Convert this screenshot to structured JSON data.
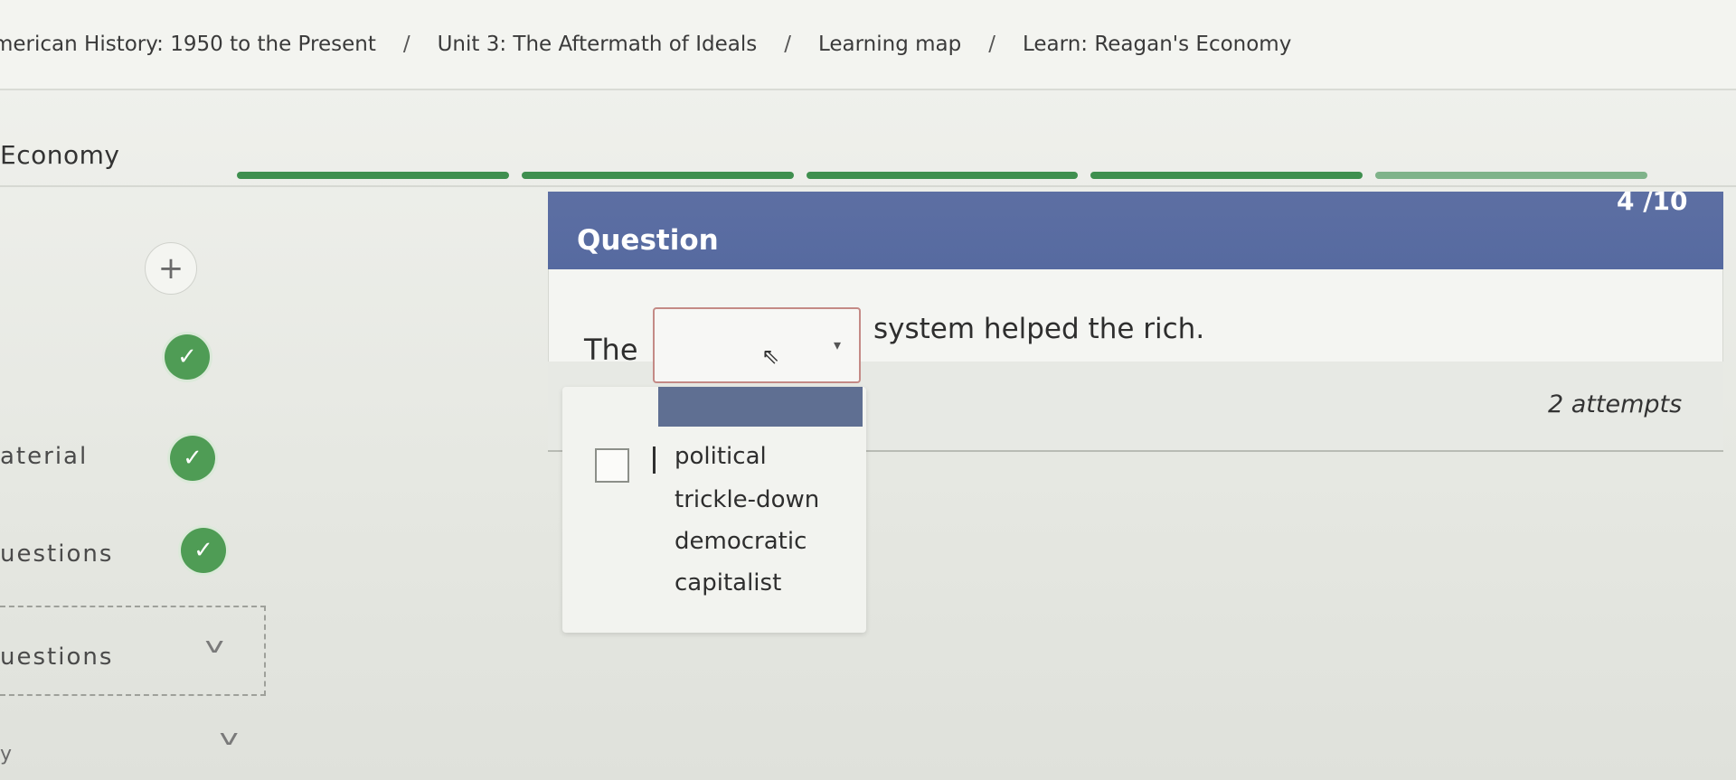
{
  "breadcrumb": {
    "items": [
      "merican History: 1950 to the Present",
      "Unit 3: The Aftermath of Ideals",
      "Learning map",
      "Learn: Reagan's Economy"
    ],
    "separator": "/"
  },
  "page": {
    "title": "Economy"
  },
  "progress": {
    "completed_segments": 4,
    "total_segments": 5
  },
  "sidebar": {
    "add_icon": "+",
    "check_icon": "✓",
    "labels": [
      "aterial",
      "uestions",
      "uestions"
    ],
    "chevron_icon": "v",
    "bottom_partial": "y"
  },
  "question": {
    "header_label": "Question",
    "counter": "4 /10",
    "sentence_start": "The",
    "sentence_end": "system helped the rich.",
    "attempts": "2 attempts",
    "dropdown": {
      "caret_icon": "▾",
      "cursor_icon": "⇖",
      "selected_value": "",
      "options": [
        "political",
        "trickle-down",
        "democratic",
        "capitalist"
      ]
    }
  },
  "colors": {
    "header_blue": "#5d6fa3",
    "check_green": "#4f9c55",
    "progress_green": "#3f8f4f",
    "dropdown_border": "#c48a86"
  }
}
